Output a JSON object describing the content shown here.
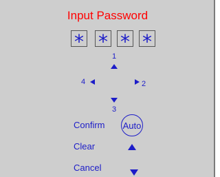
{
  "title": "Input Password",
  "password_boxes": [
    "*",
    "*",
    "*",
    "*"
  ],
  "directions": {
    "up_label": "1",
    "right_label": "2",
    "down_label": "3",
    "left_label": "4"
  },
  "actions": {
    "confirm": "Confirm",
    "clear": "Clear",
    "cancel": "Cancel",
    "auto": "Auto"
  },
  "colors": {
    "title": "#ff0000",
    "accent": "#1c1cc8",
    "panel": "#cecece"
  }
}
